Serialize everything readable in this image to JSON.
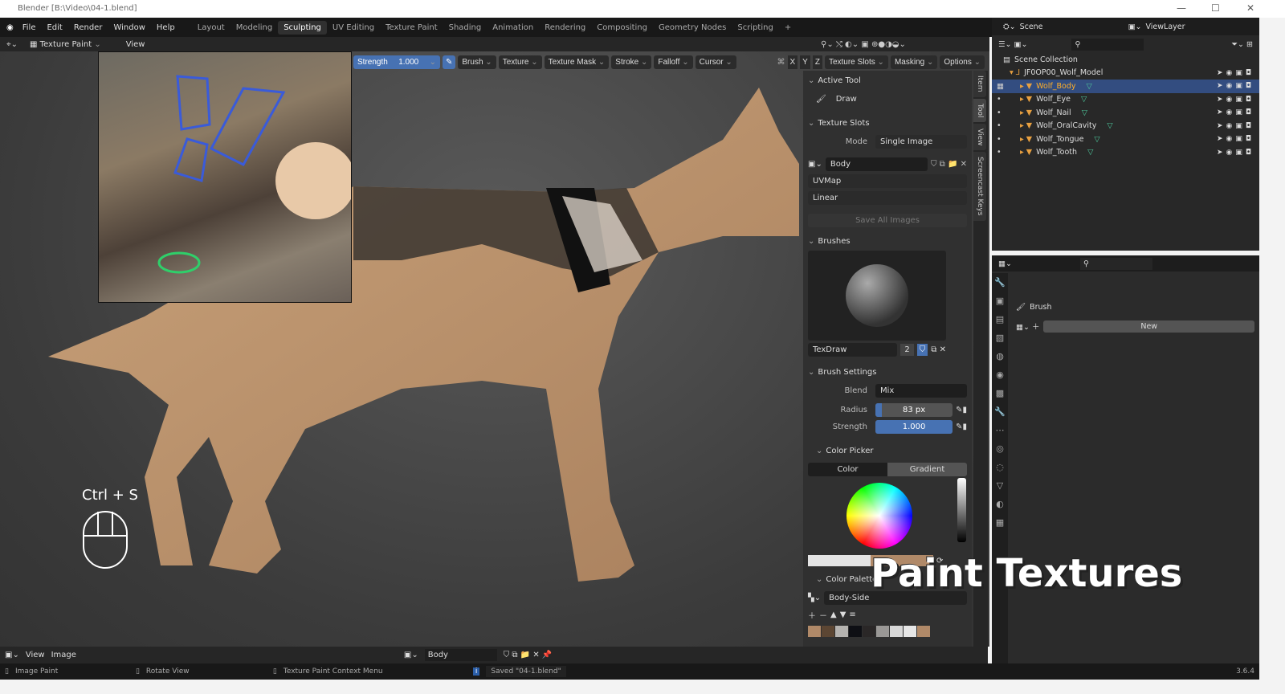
{
  "title": "Blender [B:\\Video\\04-1.blend]",
  "menu": [
    "File",
    "Edit",
    "Render",
    "Window",
    "Help"
  ],
  "workspaces": [
    "Layout",
    "Modeling",
    "Sculpting",
    "UV Editing",
    "Texture Paint",
    "Shading",
    "Animation",
    "Rendering",
    "Compositing",
    "Geometry Nodes",
    "Scripting",
    "+"
  ],
  "active_workspace": "Sculpting",
  "header": {
    "mode": "Texture Paint",
    "view": "View"
  },
  "toolbar": {
    "strength_label": "Strength",
    "strength_value": "1.000",
    "items": [
      "Brush",
      "Texture",
      "Texture Mask",
      "Stroke",
      "Falloff",
      "Cursor"
    ],
    "axes": [
      "X",
      "Y",
      "Z"
    ],
    "right_items": [
      "Texture Slots",
      "Masking",
      "Options"
    ]
  },
  "npanel": {
    "active_tool": {
      "title": "Active Tool",
      "tool": "Draw"
    },
    "texture_slots": {
      "title": "Texture Slots",
      "mode_label": "Mode",
      "mode": "Single Image",
      "image": "Body",
      "uvmap": "UVMap",
      "interp": "Linear",
      "save_all": "Save All Images"
    },
    "brushes": {
      "title": "Brushes",
      "name": "TexDraw",
      "users": "2"
    },
    "brush_settings": {
      "title": "Brush Settings",
      "blend_label": "Blend",
      "blend": "Mix",
      "radius_label": "Radius",
      "radius": "83 px",
      "strength_label": "Strength",
      "strength": "1.000",
      "radius_fraction": 0.08,
      "strength_fraction": 1.0
    },
    "color_picker": {
      "title": "Color Picker",
      "tab_color": "Color",
      "tab_gradient": "Gradient",
      "primary": "#e4e4e4",
      "secondary": "#b08968"
    },
    "color_palette": {
      "title": "Color Palette",
      "name": "Body-Side",
      "swatches": [
        "#b08968",
        "#5c4633",
        "#b5b3b0",
        "#0e0f14",
        "#2a2727",
        "#9a9896",
        "#d8d8d8",
        "#e6e6e6",
        "#b08968"
      ]
    },
    "tabs": [
      "Item",
      "Tool",
      "View",
      "Screencast Keys"
    ]
  },
  "outliner": {
    "scene": "Scene",
    "view_layer": "ViewLayer",
    "root": "Scene Collection",
    "collection": "JF0OP00_Wolf_Model",
    "items": [
      {
        "name": "Wolf_Body",
        "selected": true
      },
      {
        "name": "Wolf_Eye"
      },
      {
        "name": "Wolf_Nail"
      },
      {
        "name": "Wolf_OralCavity"
      },
      {
        "name": "Wolf_Tongue"
      },
      {
        "name": "Wolf_Tooth"
      }
    ]
  },
  "properties": {
    "section": "Brush",
    "new_label": "New"
  },
  "image_editor": {
    "view": "View",
    "image": "Image",
    "image_name": "Body"
  },
  "status": {
    "left": "Image Paint",
    "middle": "Rotate View",
    "right": "Texture Paint Context Menu",
    "message": "Saved \"04-1.blend\"",
    "version": "3.6.4"
  },
  "overlay": {
    "title": "Paint Textures",
    "keys": "Ctrl + S"
  }
}
